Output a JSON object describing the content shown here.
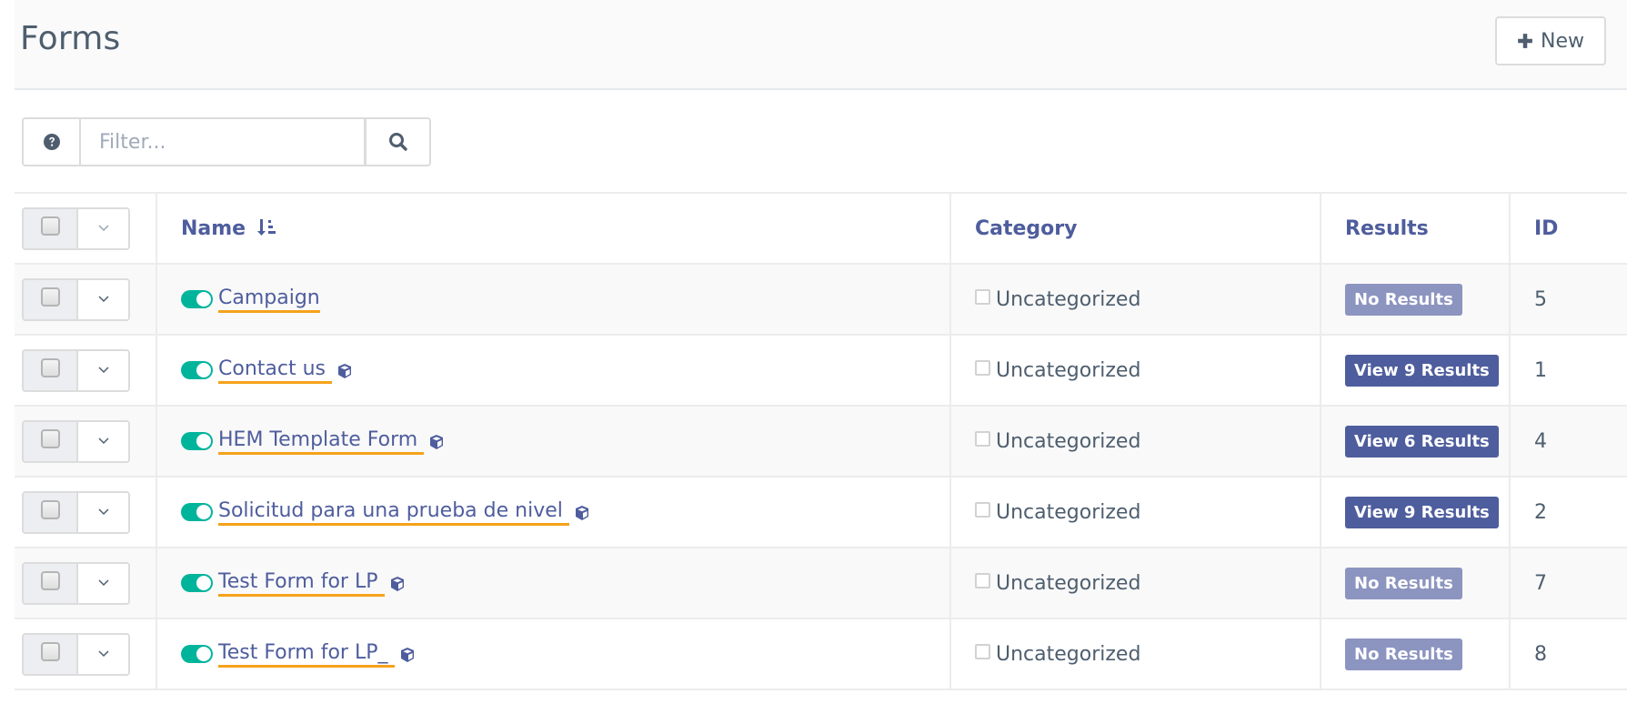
{
  "header": {
    "title": "Forms",
    "new_button_label": "New",
    "new_button_icon": "plus-icon"
  },
  "filter": {
    "help_icon": "question-circle-icon",
    "placeholder": "Filter...",
    "value": "",
    "search_icon": "search-icon"
  },
  "table": {
    "columns": {
      "name": "Name",
      "name_sort_icon": "sort-amount-asc-icon",
      "category": "Category",
      "results": "Results",
      "id": "ID"
    },
    "rows": [
      {
        "name": "Campaign",
        "published": true,
        "has_cube_icon": false,
        "category": "Uncategorized",
        "results_label": "No Results",
        "results_count": 0,
        "id": "5"
      },
      {
        "name": "Contact us ",
        "published": true,
        "has_cube_icon": true,
        "category": "Uncategorized",
        "results_label": "View 9 Results",
        "results_count": 9,
        "id": "1"
      },
      {
        "name": "HEM Template Form ",
        "published": true,
        "has_cube_icon": true,
        "category": "Uncategorized",
        "results_label": "View 6 Results",
        "results_count": 6,
        "id": "4"
      },
      {
        "name": "Solicitud para una prueba de nivel ",
        "published": true,
        "has_cube_icon": true,
        "category": "Uncategorized",
        "results_label": "View 9 Results",
        "results_count": 9,
        "id": "2"
      },
      {
        "name": "Test Form for LP ",
        "published": true,
        "has_cube_icon": true,
        "category": "Uncategorized",
        "results_label": "No Results",
        "results_count": 0,
        "id": "7"
      },
      {
        "name": "Test Form for LP_ ",
        "published": true,
        "has_cube_icon": true,
        "category": "Uncategorized",
        "results_label": "No Results",
        "results_count": 0,
        "id": "8"
      }
    ]
  },
  "colors": {
    "accent": "#4e5d9d",
    "badge_empty": "#8c94c0",
    "badge_results": "#4e5d9d",
    "toggle_on": "#00b49c",
    "link_underline": "#f5a21b",
    "text": "#4e5e6e"
  }
}
